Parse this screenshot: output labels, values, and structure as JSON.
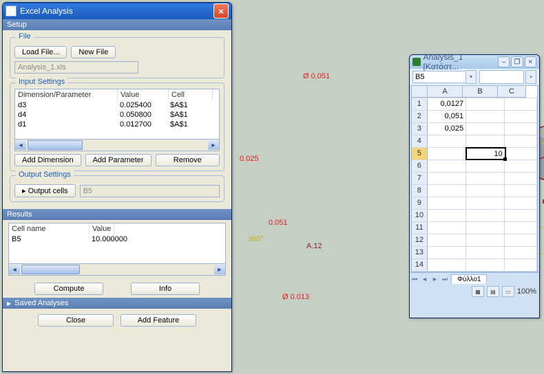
{
  "dialog": {
    "title": "Excel Analysis",
    "sections": {
      "setup": "Setup",
      "results": "Results",
      "saved": "Saved Analyses"
    },
    "file": {
      "title": "File",
      "load": "Load File...",
      "new": "New File",
      "path": "Analysis_1.xls"
    },
    "input": {
      "title": "Input Settings",
      "headers": {
        "p": "Dimension/Parameter",
        "v": "Value",
        "c": "Cell"
      },
      "rows": [
        {
          "p": "d3",
          "v": "0.025400",
          "c": "$A$1"
        },
        {
          "p": "d4",
          "v": "0.050800",
          "c": "$A$1"
        },
        {
          "p": "d1",
          "v": "0.012700",
          "c": "$A$1"
        }
      ],
      "addDim": "Add Dimension",
      "addParam": "Add Parameter",
      "remove": "Remove"
    },
    "output": {
      "title": "Output Settings",
      "btn": "Output cells",
      "val": "B5"
    },
    "resultsTable": {
      "headers": {
        "n": "Cell name",
        "v": "Value"
      },
      "rows": [
        {
          "n": "B5",
          "v": "10.000000"
        }
      ]
    },
    "compute": "Compute",
    "info": "Info",
    "close": "Close",
    "addFeature": "Add Feature"
  },
  "viewport": {
    "dims": {
      "d051a": "Ø 0.051",
      "d025": "0.025",
      "d051b": "0.051",
      "dA12": "A.12",
      "d013": "Ø 0.013",
      "ang": "360°"
    }
  },
  "excel": {
    "title": "Analysis_1  [Κατάστ...",
    "nameBox": "B5",
    "cols": {
      "A": "A",
      "B": "B",
      "C": "C"
    },
    "cells": {
      "A1": "0,0127",
      "A2": "0,051",
      "A3": "0,025",
      "B5": "10"
    },
    "sheetTab": "Φύλλο1",
    "zoom": "100%"
  }
}
